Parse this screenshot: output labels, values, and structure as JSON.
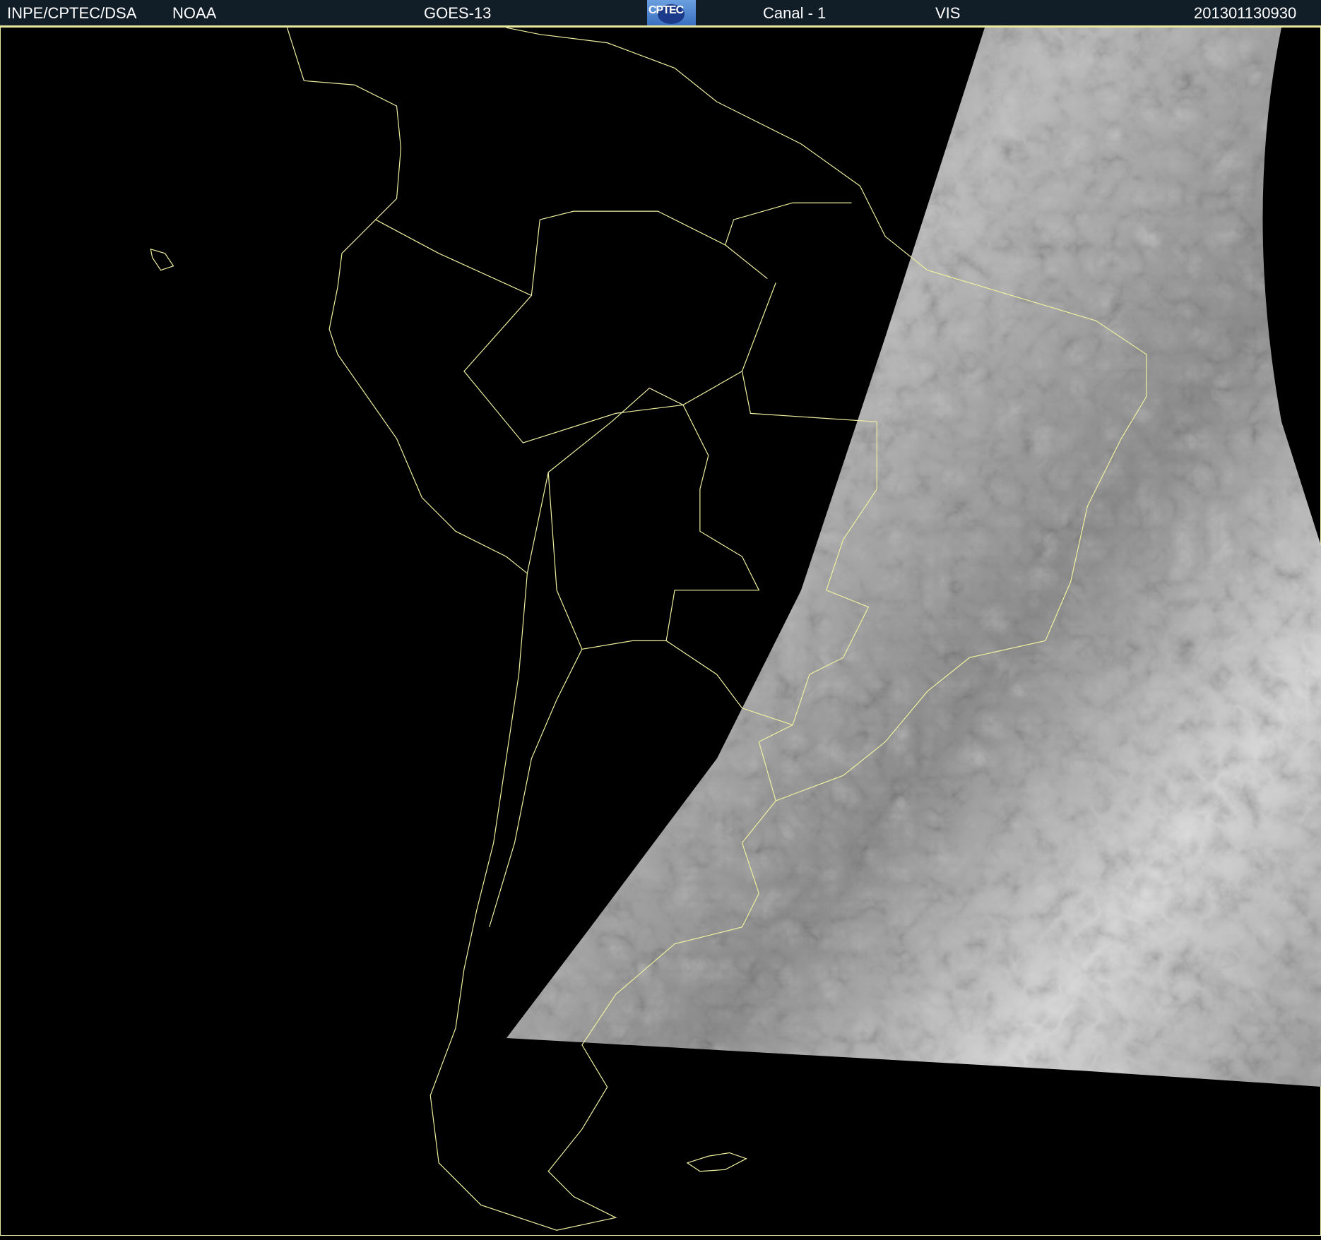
{
  "header": {
    "source": "INPE/CPTEC/DSA",
    "agency": "NOAA",
    "satellite": "GOES-13",
    "logo_text": "CPTEC",
    "channel": "Canal - 1",
    "band": "VIS",
    "datetime": "201301130930"
  },
  "colors": {
    "header_bg": "#111d27",
    "coastline": "#f0f0a0"
  }
}
